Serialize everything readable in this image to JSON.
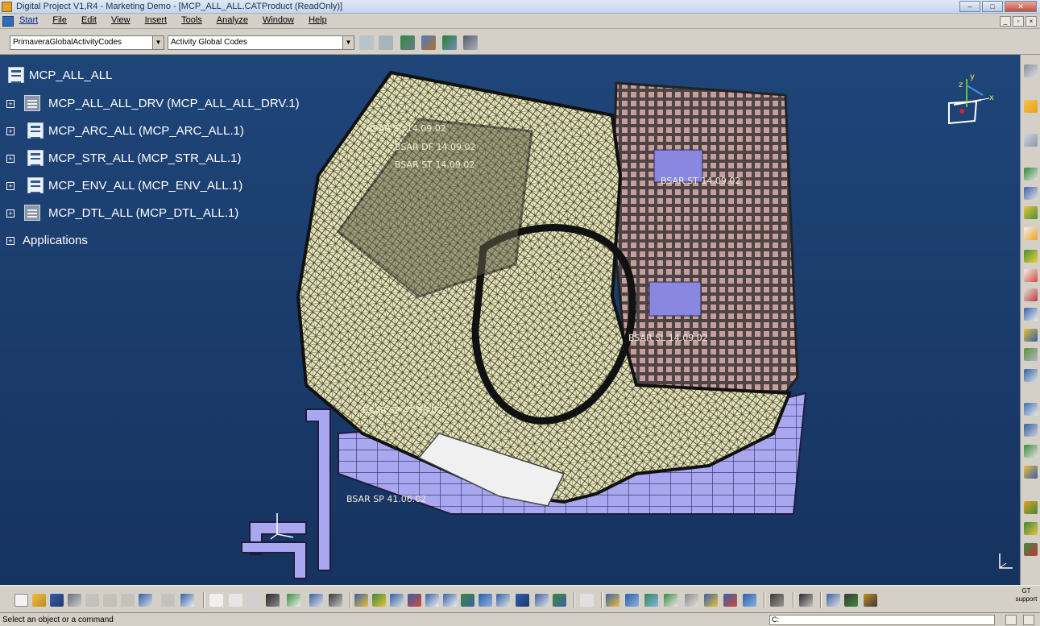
{
  "window": {
    "title": "Digital Project V1,R4 - Marketing Demo - [MCP_ALL_ALL.CATProduct (ReadOnly)]",
    "controls": [
      "–",
      "□",
      "✕"
    ],
    "mdi_controls": [
      "_",
      "▫",
      "×"
    ]
  },
  "menu": {
    "items": [
      "Start",
      "File",
      "Edit",
      "View",
      "Insert",
      "Tools",
      "Analyze",
      "Window",
      "Help"
    ]
  },
  "top_toolbar": {
    "combo1_value": "PrimaveraGlobalActivityCodes",
    "combo2_value": "Activity Global Codes",
    "icons": [
      "codes-icon-1",
      "codes-icon-2",
      "codes-icon-3",
      "codes-icon-4",
      "codes-icon-5",
      "codes-icon-6"
    ]
  },
  "tree": {
    "root": "MCP_ALL_ALL",
    "children": [
      {
        "label": "MCP_ALL_ALL_DRV (MCP_ALL_ALL_DRV.1)",
        "type": "part"
      },
      {
        "label": "MCP_ARC_ALL (MCP_ARC_ALL.1)",
        "type": "product"
      },
      {
        "label": "MCP_STR_ALL (MCP_STR_ALL.1)",
        "type": "product"
      },
      {
        "label": "MCP_ENV_ALL (MCP_ENV_ALL.1)",
        "type": "product"
      },
      {
        "label": "MCP_DTL_ALL (MCP_DTL_ALL.1)",
        "type": "part"
      }
    ],
    "applications": "Applications"
  },
  "viewport": {
    "background": "#1c3f72",
    "model_color": "#e6e4b8",
    "grid_color": "#7d6f6f",
    "base_color": "#a9a7f0",
    "annotations": [
      "BSAR  SL 14.09.02",
      "BSAR  DF 14.09.02",
      "BSAR  ST 14.09.02",
      "BSAR  SP 41.06.02"
    ]
  },
  "compass": {
    "x_label": "x",
    "y_label": "y",
    "z_label": "z"
  },
  "bottom_toolbar": {
    "gt_support_line1": "GT",
    "gt_support_line2": "support"
  },
  "statusbar": {
    "message": "Select an object or a command",
    "cmd_prefix": "C:"
  }
}
